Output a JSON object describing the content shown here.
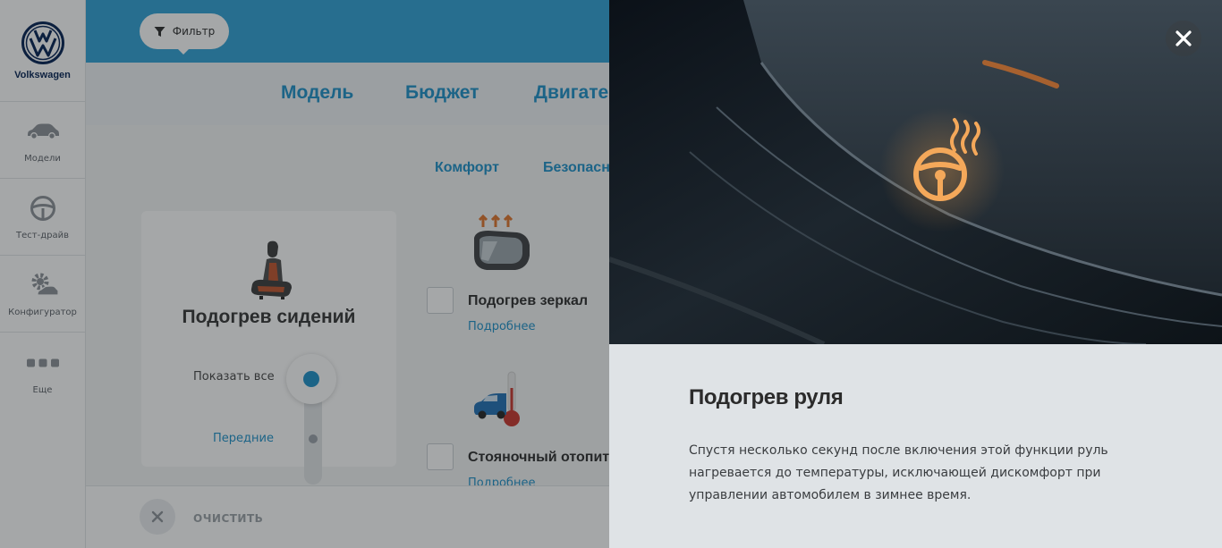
{
  "brand": {
    "name": "Volkswagen",
    "logo_icon": "vw-logo"
  },
  "sidebar": {
    "items": [
      {
        "label": "Модели",
        "icon": "car-icon"
      },
      {
        "label": "Тест-драйв",
        "icon": "steering-wheel-icon"
      },
      {
        "label": "Конфигуратор",
        "icon": "configurator-gear-car-icon"
      },
      {
        "label": "Еще",
        "icon": "more-dots-icon"
      }
    ]
  },
  "topbar": {
    "filter_label": "Фильтр",
    "filter_icon": "funnel-icon",
    "color": "#2ea1d6"
  },
  "main_tabs": [
    "Модель",
    "Бюджет",
    "Двигате"
  ],
  "sub_tabs": [
    "Комфорт",
    "Безопасно"
  ],
  "seat_card": {
    "title": "Подогрев сидений",
    "show_all": "Показать все",
    "option_label": "Передние"
  },
  "features": [
    {
      "name": "Подогрев зеркал",
      "more": "Подробнее",
      "icon": "heated-mirror-icon"
    },
    {
      "name": "Стояночный отопител",
      "more": "Подробнее",
      "icon": "parking-heater-car-icon"
    }
  ],
  "bottom_bar": {
    "clear_label": "ОЧИСТИТЬ"
  },
  "modal": {
    "title": "Подогрев руля",
    "description": "Спустя несколько секунд после включения этой функции руль нагревается до температуры, исключающей дискомфорт при управлении автомобилем в зимнее время.",
    "close_icon": "close-icon",
    "photo_icon": "heated-steering-wheel-icon"
  },
  "colors": {
    "accent": "#1b8fc9",
    "brand": "#001e50",
    "glow": "#f0a04a"
  }
}
